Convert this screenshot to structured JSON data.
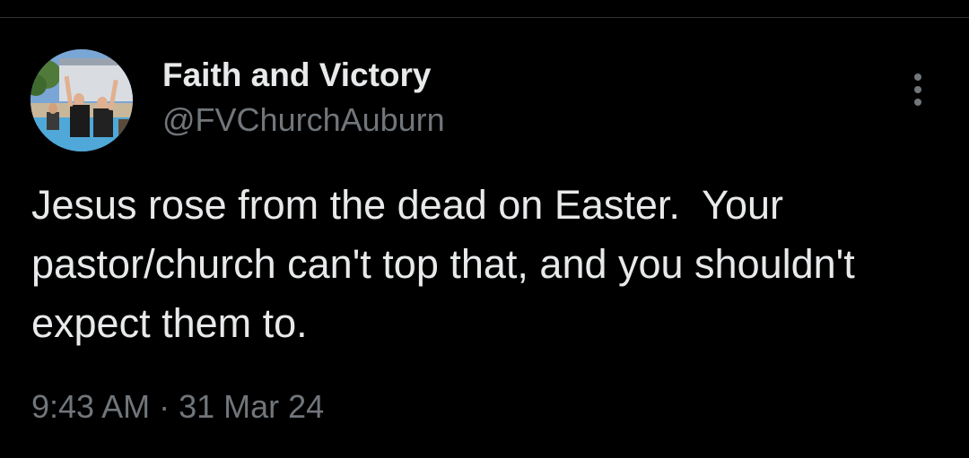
{
  "tweet": {
    "author": {
      "display_name": "Faith and Victory",
      "handle": "@FVChurchAuburn",
      "avatar": "church-baptism-photo"
    },
    "text": "Jesus rose from the dead on Easter.  Your pastor/church can't top that, and you shouldn't expect them to.",
    "timestamp": "9:43 AM · 31 Mar 24",
    "more_icon": "more-vertical-icon"
  },
  "colors": {
    "background": "#000000",
    "primary_text": "#e7e9ea",
    "secondary_text": "#71767b",
    "divider": "#2f3336"
  }
}
